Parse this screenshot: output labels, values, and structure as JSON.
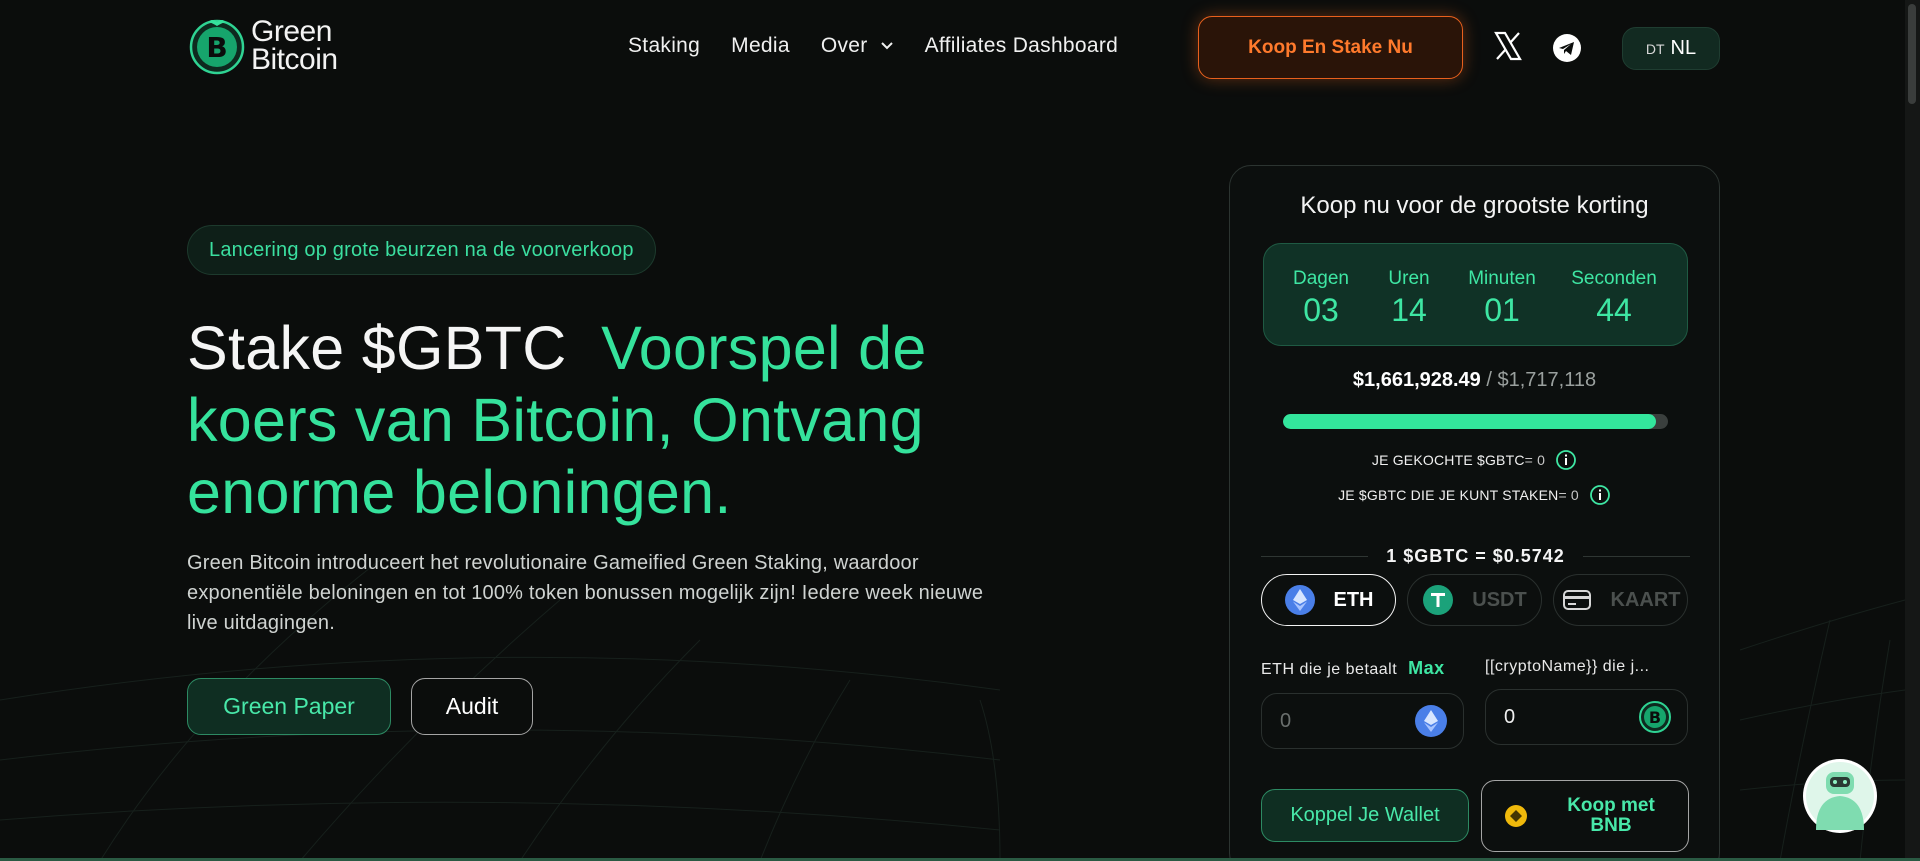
{
  "header": {
    "logo_line1": "Green",
    "logo_line2": "Bitcoin",
    "nav": {
      "staking": "Staking",
      "media": "Media",
      "over": "Over",
      "affiliates": "Affiliates Dashboard"
    },
    "cta": "Koop En Stake Nu",
    "lang_abbr": "DT",
    "lang": "NL"
  },
  "hero": {
    "badge": "Lancering op grote beurzen na de voorverkoop",
    "title_white": "Stake $GBTC",
    "title_green": "Voorspel de koers van Bitcoin, Ontvang enorme beloningen.",
    "description": "Green Bitcoin introduceert het revolutionaire Gameified Green Staking, waardoor exponentiële beloningen en tot 100% token bonussen mogelijk zijn! Iedere week nieuwe live uitdagingen.",
    "btn_paper": "Green Paper",
    "btn_audit": "Audit"
  },
  "widget": {
    "title": "Koop nu voor de grootste korting",
    "countdown": {
      "days_label": "Dagen",
      "days": "03",
      "hours_label": "Uren",
      "hours": "14",
      "minutes_label": "Minuten",
      "minutes": "01",
      "seconds_label": "Seconden",
      "seconds": "44"
    },
    "raised": "$1,661,928.49",
    "raised_sep": "/",
    "target": "$1,717,118",
    "progress_percent": 96.8,
    "bought_label": "JE GEKOCHTE $GBTC",
    "bought_value": "= 0",
    "stakeable_label": "JE $GBTC DIE JE KUNT STAKEN",
    "stakeable_value": "= 0",
    "rate": "1 $GBTC = $0.5742",
    "tabs": {
      "eth": "ETH",
      "usdt": "USDT",
      "card": "KAART"
    },
    "pay_label": "ETH die je betaalt",
    "max_label": "Max",
    "receive_label": "[[cryptoName}} die j...",
    "pay_value": "0",
    "receive_value": "0",
    "btn_wallet": "Koppel Je Wallet",
    "btn_bnb": "Koop met BNB"
  },
  "colors": {
    "accent_green": "#35e29c",
    "cta_orange": "#ff7a2c",
    "background": "#0b0d0c"
  },
  "icons": {
    "x": "x-logo-icon",
    "telegram": "telegram-icon",
    "eth": "ethereum-icon",
    "usdt": "tether-icon",
    "card": "credit-card-icon",
    "gbtc": "green-bitcoin-icon",
    "bnb": "bnb-icon",
    "info": "info-icon",
    "chat": "chat-mascot-icon"
  }
}
